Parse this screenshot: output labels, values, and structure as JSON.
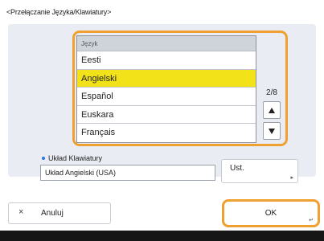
{
  "title": "<Przełączanie Języka/Klawiatury>",
  "language_list": {
    "header": "Język",
    "items": [
      {
        "label": "Eesti",
        "selected": false
      },
      {
        "label": "Angielski",
        "selected": true
      },
      {
        "label": "Español",
        "selected": false
      },
      {
        "label": "Euskara",
        "selected": false
      },
      {
        "label": "Français",
        "selected": false
      }
    ],
    "page_indicator": "2/8"
  },
  "keyboard": {
    "label": "Układ Klawiatury",
    "value": "Układ Angielski (USA)",
    "settings_button": "Ust."
  },
  "footer": {
    "cancel_icon": "×",
    "cancel_label": "Anuluj",
    "ok_label": "OK"
  },
  "colors": {
    "focus_outline": "#f0a030",
    "selected_row": "#f2e21a",
    "panel_bg": "#e9ecf2",
    "bullet": "#2a78d8"
  }
}
